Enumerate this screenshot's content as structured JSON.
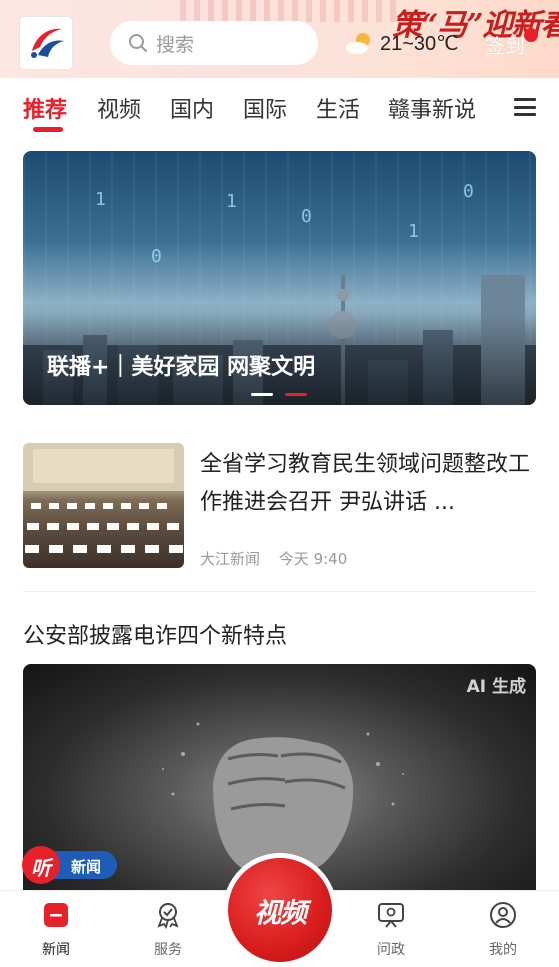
{
  "header": {
    "search_placeholder": "搜索",
    "weather": "21~30℃",
    "signin_label": "签到",
    "promo": "策“马”迎新春"
  },
  "tabs": [
    {
      "label": "推荐",
      "active": true
    },
    {
      "label": "视频",
      "active": false
    },
    {
      "label": "国内",
      "active": false
    },
    {
      "label": "国际",
      "active": false
    },
    {
      "label": "生活",
      "active": false
    },
    {
      "label": "赣事新说",
      "active": false
    }
  ],
  "banner": {
    "title": "联播+｜美好家园 网聚文明",
    "slide_count": 2,
    "active_slide": 2
  },
  "news": {
    "title": "全省学习教育民生领域问题整改工作推进会召开 尹弘讲话 ...",
    "source": "大江新闻",
    "time": "今天 9:40"
  },
  "article": {
    "title": "公安部披露电诈四个新特点",
    "ai_badge": "AI 生成"
  },
  "listen_badge": {
    "char": "听",
    "label": "新闻"
  },
  "bottom_nav": [
    {
      "label": "新闻",
      "icon": "news-icon",
      "active": true
    },
    {
      "label": "服务",
      "icon": "service-icon",
      "active": false
    },
    {
      "label": "视频",
      "icon": "video-icon",
      "active": false
    },
    {
      "label": "问政",
      "icon": "inquiry-icon",
      "active": false
    },
    {
      "label": "我的",
      "icon": "profile-icon",
      "active": false
    }
  ],
  "colors": {
    "accent": "#e8202a",
    "text": "#222222",
    "muted": "#999999"
  }
}
